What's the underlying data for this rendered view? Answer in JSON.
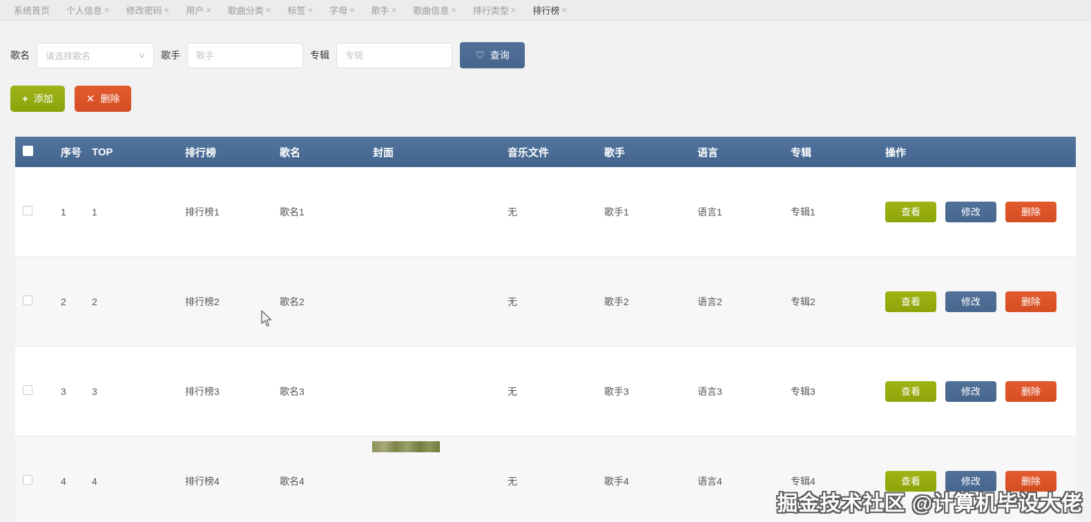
{
  "tabs": [
    {
      "label": "系统首页",
      "closable": false,
      "active": false
    },
    {
      "label": "个人信息",
      "closable": true,
      "active": false
    },
    {
      "label": "修改密码",
      "closable": true,
      "active": false
    },
    {
      "label": "用户",
      "closable": true,
      "active": false
    },
    {
      "label": "歌曲分类",
      "closable": true,
      "active": false
    },
    {
      "label": "标签",
      "closable": true,
      "active": false
    },
    {
      "label": "字母",
      "closable": true,
      "active": false
    },
    {
      "label": "歌手",
      "closable": true,
      "active": false
    },
    {
      "label": "歌曲信息",
      "closable": true,
      "active": false
    },
    {
      "label": "排行类型",
      "closable": true,
      "active": false
    },
    {
      "label": "排行榜",
      "closable": true,
      "active": true
    }
  ],
  "search": {
    "song_label": "歌名",
    "song_placeholder": "请选择歌名",
    "singer_label": "歌手",
    "singer_placeholder": "歌手",
    "album_label": "专辑",
    "album_placeholder": "专辑",
    "query_label": "查询",
    "query_icon": "♡",
    "chevron_icon": "∨"
  },
  "toolbar": {
    "add_label": "添加",
    "add_icon": "+",
    "delete_label": "删除",
    "delete_icon": "✕"
  },
  "table": {
    "headers": [
      "序号",
      "TOP",
      "排行榜",
      "歌名",
      "封面",
      "音乐文件",
      "歌手",
      "语言",
      "专辑",
      "操作"
    ],
    "action_labels": [
      "查看",
      "修改",
      "删除"
    ],
    "rows": [
      {
        "no": "1",
        "top": "1",
        "rank": "排行榜1",
        "song": "歌名1",
        "cover": "",
        "music": "无",
        "singer": "歌手1",
        "language": "语言1",
        "album": "专辑1",
        "cover_partial": false
      },
      {
        "no": "2",
        "top": "2",
        "rank": "排行榜2",
        "song": "歌名2",
        "cover": "",
        "music": "无",
        "singer": "歌手2",
        "language": "语言2",
        "album": "专辑2",
        "cover_partial": false
      },
      {
        "no": "3",
        "top": "3",
        "rank": "排行榜3",
        "song": "歌名3",
        "cover": "",
        "music": "无",
        "singer": "歌手3",
        "language": "语言3",
        "album": "专辑3",
        "cover_partial": false
      },
      {
        "no": "4",
        "top": "4",
        "rank": "排行榜4",
        "song": "歌名4",
        "cover": "",
        "music": "无",
        "singer": "歌手4",
        "language": "语言4",
        "album": "专辑4",
        "cover_partial": true
      }
    ]
  },
  "watermark": "掘金技术社区 @计算机毕设大佬",
  "colors": {
    "header_blue": "#4a6d96",
    "button_green": "#95a90f",
    "button_orange": "#dc5226",
    "page_background": "#f2f2f2",
    "alt_row": "#f7f7f7"
  }
}
